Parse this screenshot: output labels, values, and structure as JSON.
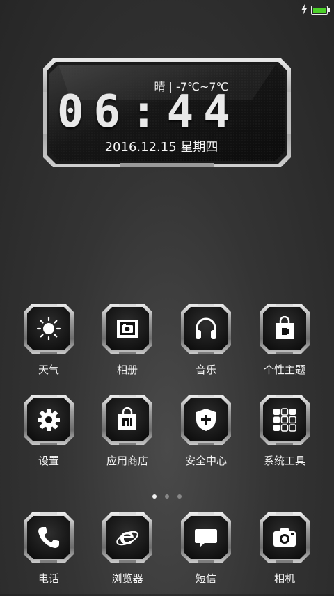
{
  "status_bar": {
    "charging_icon": "lightning-icon",
    "battery_icon": "battery-icon",
    "battery_color": "#4ccf2a"
  },
  "clock": {
    "weather": "晴 | -7℃~7℃",
    "time": "06:44",
    "date": "2016.12.15 星期四"
  },
  "apps": [
    {
      "label": "天气",
      "icon": "sun-icon"
    },
    {
      "label": "相册",
      "icon": "photo-icon"
    },
    {
      "label": "音乐",
      "icon": "headphones-icon"
    },
    {
      "label": "个性主题",
      "icon": "theme-bag-icon"
    },
    {
      "label": "设置",
      "icon": "gear-icon"
    },
    {
      "label": "应用商店",
      "icon": "mi-store-icon"
    },
    {
      "label": "安全中心",
      "icon": "shield-icon"
    },
    {
      "label": "系统工具",
      "icon": "tools-folder-icon"
    }
  ],
  "pager": {
    "pages": 3,
    "active": 0
  },
  "dock": [
    {
      "label": "电话",
      "icon": "phone-icon"
    },
    {
      "label": "浏览器",
      "icon": "browser-icon"
    },
    {
      "label": "短信",
      "icon": "message-icon"
    },
    {
      "label": "相机",
      "icon": "camera-icon"
    }
  ]
}
